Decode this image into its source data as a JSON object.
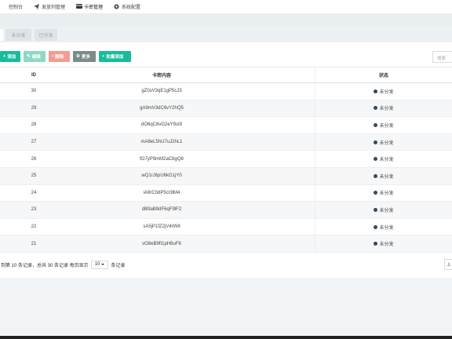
{
  "nav": {
    "items": [
      {
        "label": "控制台",
        "icon": "dashboard-icon"
      },
      {
        "label": "发放列管理",
        "icon": "send-icon"
      },
      {
        "label": "卡密管理",
        "icon": "card-icon"
      },
      {
        "label": "系统配置",
        "icon": "gear-icon"
      }
    ]
  },
  "tabs": [
    "未分发",
    "已分发"
  ],
  "toolbar": {
    "add": "添加",
    "edit": "编辑",
    "delete": "删除",
    "more": "更多",
    "batch_add": "批量添加",
    "search_placeholder": "搜索"
  },
  "table": {
    "headers": {
      "id": "ID",
      "content": "卡密内容",
      "status": "状态"
    },
    "rows": [
      {
        "id": "30",
        "content": "gZ0sV3qE1gP5cJ3",
        "status": "未分发"
      },
      {
        "id": "29",
        "content": "gA9mV3dC6vY2hQ5",
        "status": "未分发"
      },
      {
        "id": "28",
        "content": "dO6qC8vG2eY9sI9",
        "status": "未分发"
      },
      {
        "id": "27",
        "content": "mA8eL5hU7uJ2hL1",
        "status": "未分发"
      },
      {
        "id": "26",
        "content": "fO7yP9mM2aC6gQ8",
        "status": "未分发"
      },
      {
        "id": "25",
        "content": "wQ1rJ6pU6kG1jY0",
        "status": "未分发"
      },
      {
        "id": "24",
        "content": "iA9rC0dP5cI3lM4",
        "status": "未分发"
      },
      {
        "id": "23",
        "content": "dB9aB9dF6qF9lF2",
        "status": "未分发"
      },
      {
        "id": "22",
        "content": "sA5jP1fZ2jV4rW8",
        "status": "未分发"
      },
      {
        "id": "21",
        "content": "vO8eB9fI1pH8uF6",
        "status": "未分发"
      }
    ]
  },
  "pager": {
    "summary": "到第 10 条记录，总共 30 条记录 每页显示",
    "page_size": "10",
    "suffix": "条记录",
    "next": "上"
  },
  "colors": {
    "primary": "#18bc9c",
    "danger": "#f39c93",
    "muted": "#7b8a8b",
    "status_dot": "#34495e"
  }
}
